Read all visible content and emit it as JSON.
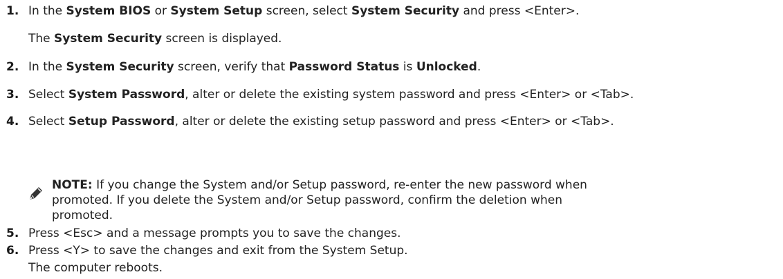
{
  "steps": [
    {
      "number": "1.",
      "parts": [
        "In the ",
        "System BIOS",
        " or ",
        "System Setup",
        " screen, select ",
        "System Security",
        " and press <Enter>."
      ],
      "result": [
        "The ",
        "System Security",
        " screen is displayed."
      ]
    },
    {
      "number": "2.",
      "parts": [
        "In the ",
        "System Security",
        " screen, verify that ",
        "Password Status",
        " is ",
        "Unlocked",
        "."
      ]
    },
    {
      "number": "3.",
      "parts": [
        "Select ",
        "System Password",
        ", alter or delete the existing system password and press <Enter> or <Tab>."
      ]
    },
    {
      "number": "4.",
      "parts": [
        "Select ",
        "Setup Password",
        ", alter or delete the existing setup password and press <Enter> or <Tab>."
      ]
    },
    {
      "number": "5.",
      "parts": [
        "Press <Esc> and a message prompts you to save the changes."
      ]
    },
    {
      "number": "6.",
      "parts": [
        "Press <Y> to save the changes and exit from the System Setup."
      ],
      "result": [
        "The computer reboots."
      ]
    }
  ],
  "note": {
    "icon": "pencil-note-icon",
    "label": "NOTE:",
    "lines": [
      " If you change the System and/or Setup password, re-enter the new password when",
      "promoted. If you delete the System and/or Setup password, confirm the deletion when",
      "promoted."
    ]
  }
}
